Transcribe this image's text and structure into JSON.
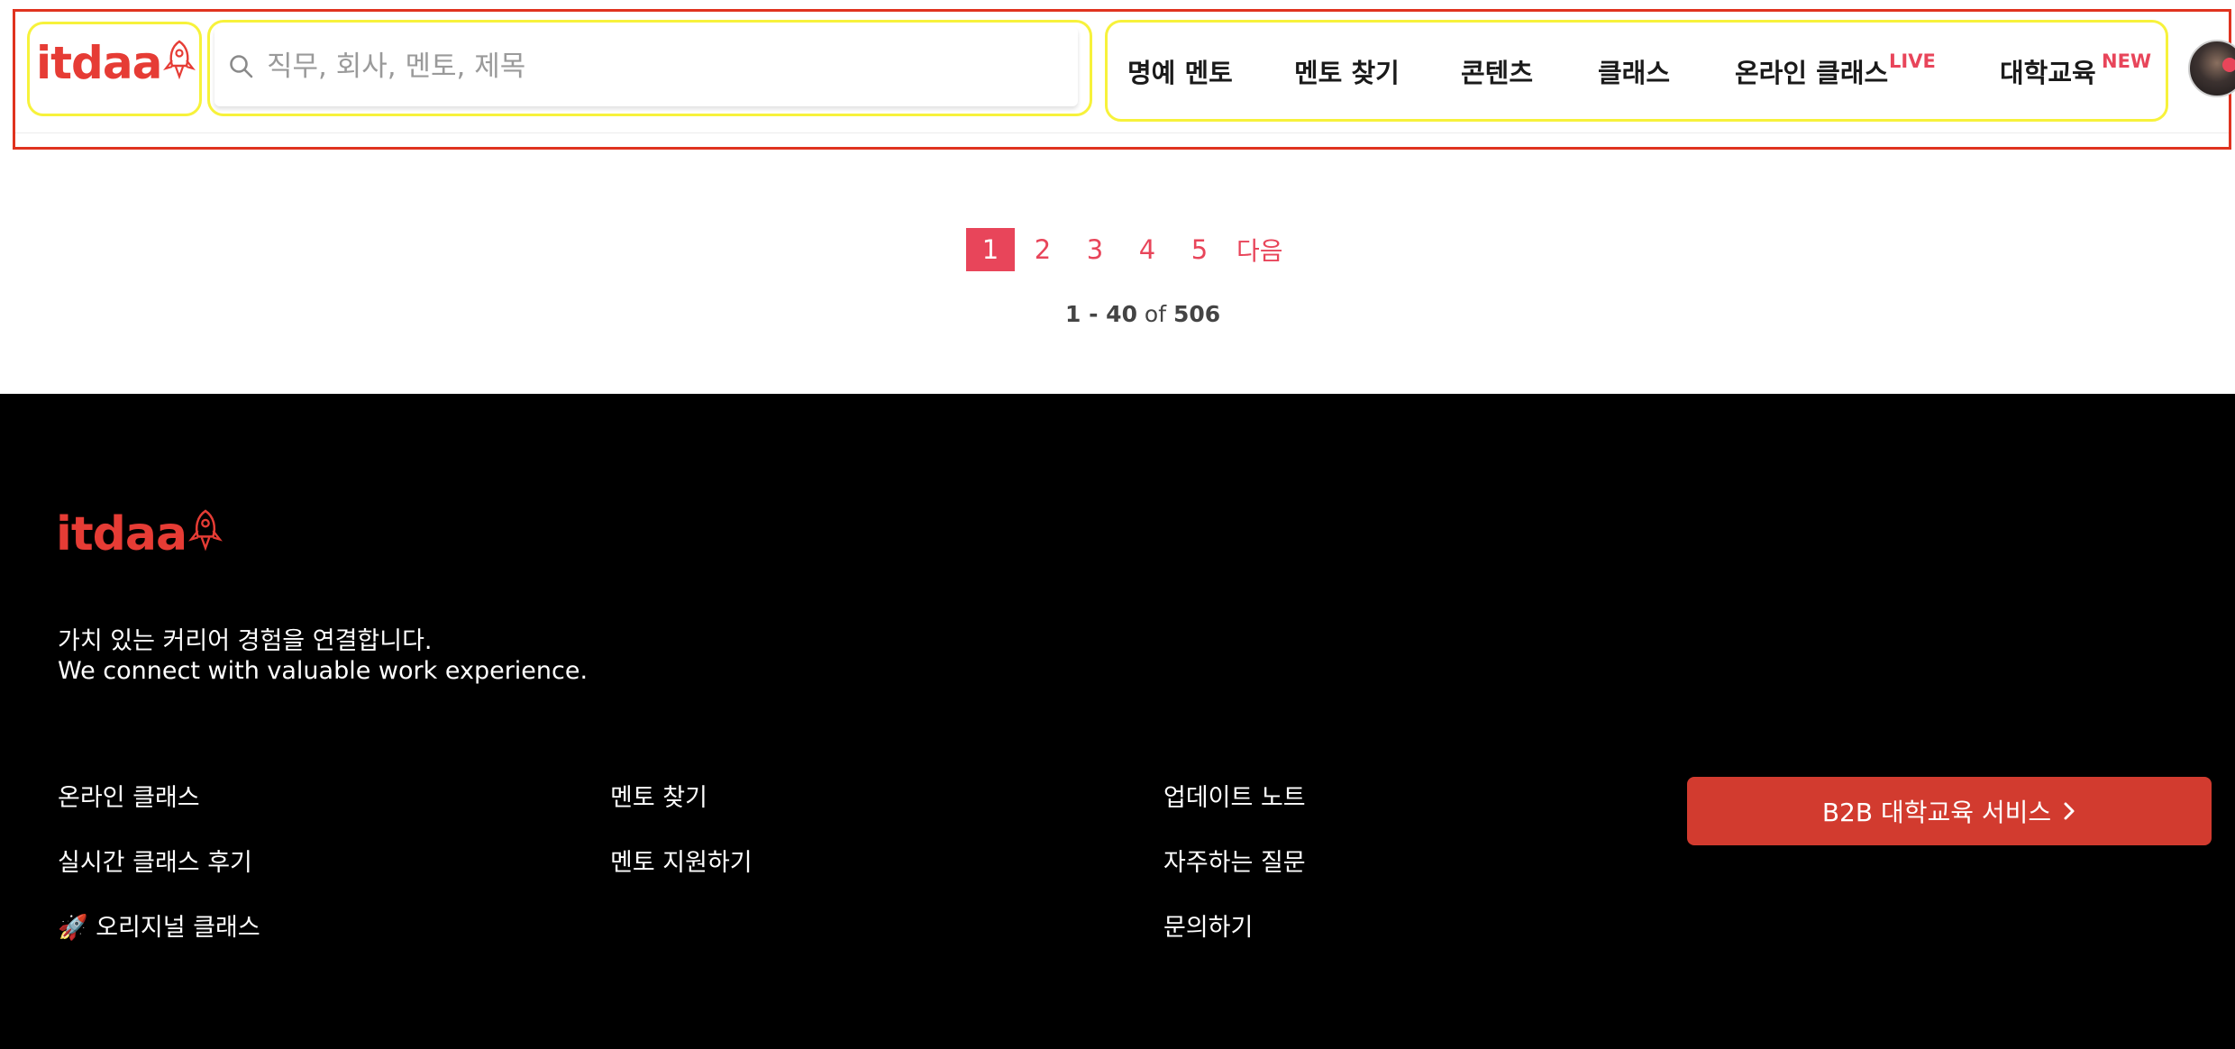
{
  "header": {
    "logo_text": "itdaa",
    "search": {
      "placeholder": "직무, 회사, 멘토, 제목",
      "value": ""
    },
    "nav": {
      "honor_mentor": "명예 멘토",
      "find_mentor": "멘토 찾기",
      "contents": "콘텐츠",
      "class": "클래스",
      "online_class": "온라인 클래스",
      "online_class_badge": "LIVE",
      "university_edu": "대학교육",
      "university_edu_badge": "NEW"
    }
  },
  "pagination": {
    "pages": [
      "1",
      "2",
      "3",
      "4",
      "5"
    ],
    "current_page": "1",
    "next_label": "다음",
    "range": "1 - 40",
    "of_label": "of",
    "total": "506"
  },
  "footer": {
    "logo_text": "itdaa",
    "tagline_ko": "가치 있는 커리어 경험을 연결합니다.",
    "tagline_en": "We connect with valuable work experience.",
    "col1": [
      "온라인 클래스",
      "실시간 클래스 후기",
      "🚀 오리지널 클래스"
    ],
    "col2": [
      "멘토 찾기",
      "멘토 지원하기"
    ],
    "col3": [
      "업데이트 노트",
      "자주하는 질문",
      "문의하기"
    ],
    "b2b_button": "B2B 대학교육 서비스"
  },
  "colors": {
    "brand": "#e63c35",
    "accent": "#e8455a",
    "b2b": "#d23b2f",
    "footer_bg": "#000000"
  },
  "icons": {
    "logo": "rocket-icon",
    "search": "search-icon",
    "b2b_arrow": "chevron-right-icon"
  }
}
